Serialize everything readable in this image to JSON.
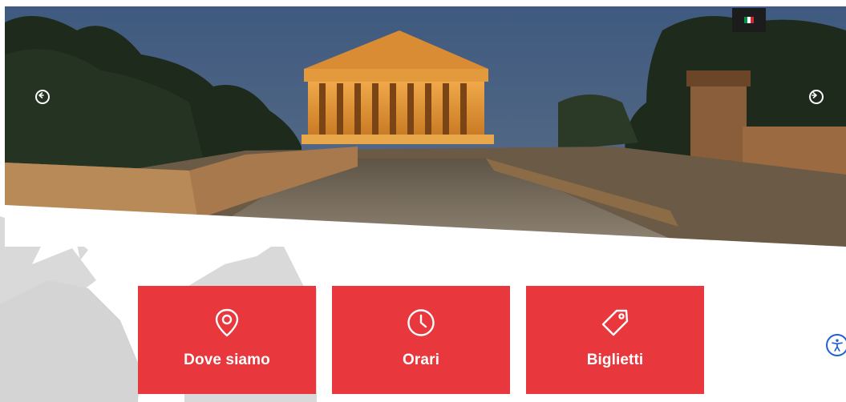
{
  "hero": {
    "carousel_prev_icon": "arrow-left-circle-icon",
    "carousel_next_icon": "arrow-right-circle-icon"
  },
  "language": {
    "current": "italian-flag-icon",
    "flag_colors": [
      "#009246",
      "#ffffff",
      "#ce2b37"
    ]
  },
  "cards": [
    {
      "label": "Dove siamo",
      "icon": "location-pin-icon"
    },
    {
      "label": "Orari",
      "icon": "clock-icon"
    },
    {
      "label": "Biglietti",
      "icon": "ticket-tag-icon"
    }
  ],
  "accessibility": {
    "icon": "accessibility-icon"
  },
  "colors": {
    "accent": "#e8383d",
    "accessibility": "#1e5fd8"
  }
}
